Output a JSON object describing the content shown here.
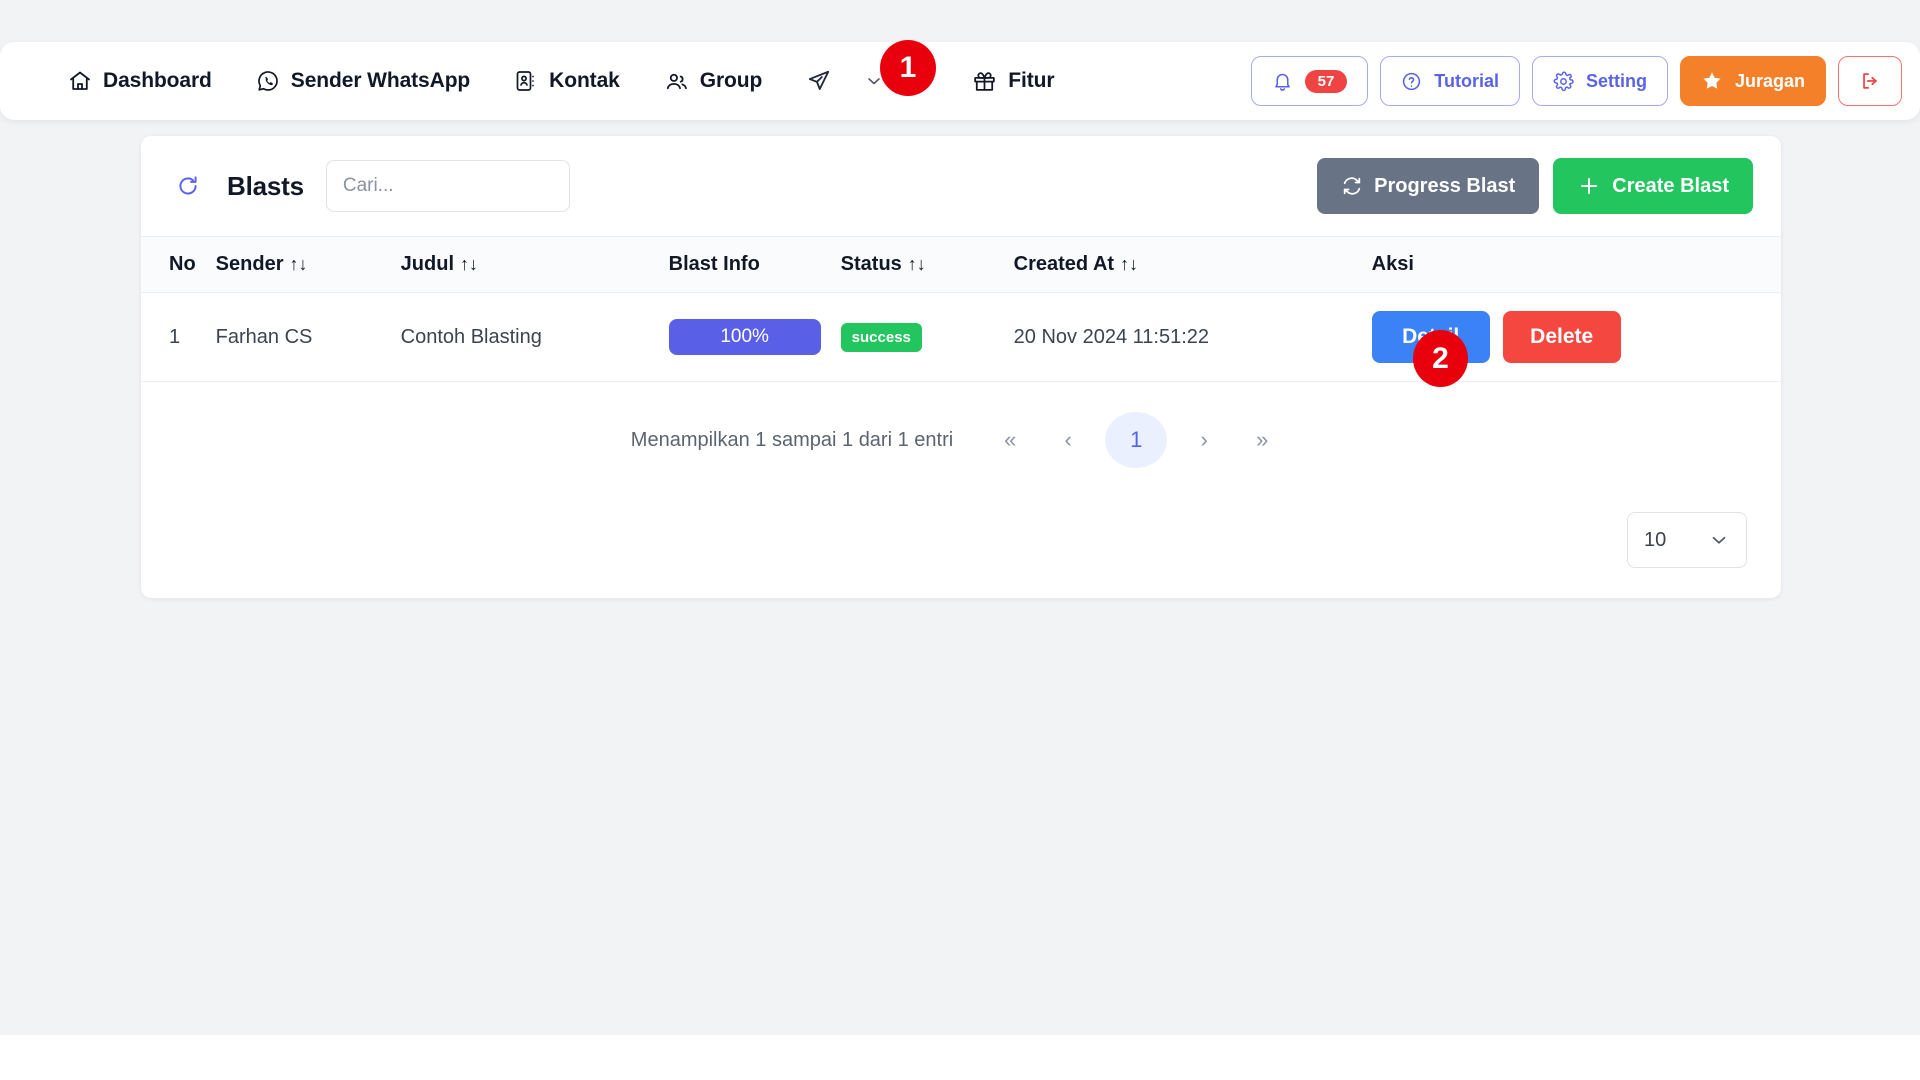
{
  "navbar": {
    "items": [
      {
        "label": "Dashboard",
        "icon": "home-icon"
      },
      {
        "label": "Sender WhatsApp",
        "icon": "whatsapp-icon"
      },
      {
        "label": "Kontak",
        "icon": "contact-card-icon"
      },
      {
        "label": "Group",
        "icon": "people-icon"
      },
      {
        "label": "",
        "icon": "send-paperplane-icon"
      },
      {
        "label": "Fitur",
        "icon": "gift-icon"
      }
    ],
    "notification": {
      "icon": "bell-icon",
      "count": "57"
    },
    "tutorial": {
      "icon": "question-circle-icon",
      "label": "Tutorial"
    },
    "setting": {
      "icon": "gear-icon",
      "label": "Setting"
    },
    "juragan": {
      "icon": "star-icon",
      "label": "Juragan"
    },
    "logout": {
      "icon": "logout-icon"
    }
  },
  "card": {
    "refresh_icon": "refresh-icon",
    "title": "Blasts",
    "search": {
      "value": "",
      "placeholder": "Cari..."
    },
    "progress_blast": {
      "icon": "sync-icon",
      "label": "Progress Blast"
    },
    "create_blast": {
      "icon": "plus-icon",
      "label": "Create Blast"
    }
  },
  "table": {
    "columns": [
      {
        "label": "No",
        "sortable": false
      },
      {
        "label": "Sender",
        "sortable": true
      },
      {
        "label": "Judul",
        "sortable": true
      },
      {
        "label": "Blast Info",
        "sortable": false
      },
      {
        "label": "Status",
        "sortable": true
      },
      {
        "label": "Created At",
        "sortable": true
      },
      {
        "label": "Aksi",
        "sortable": false
      }
    ],
    "sort_glyph": "↑↓",
    "rows": [
      {
        "no": "1",
        "sender": "Farhan CS",
        "judul": "Contoh Blasting",
        "blast_info": "100%",
        "blast_percent": 100,
        "status": "success",
        "created_at": "20 Nov 2024 11:51:22",
        "action_detail": "Detail",
        "action_delete": "Delete"
      }
    ]
  },
  "pagination": {
    "info": "Menampilkan 1 sampai 1 dari 1 entri",
    "first": "«",
    "prev": "‹",
    "current_page": "1",
    "next": "›",
    "last": "»"
  },
  "page_size": {
    "value": "10",
    "chevron": "chevron-down-icon"
  },
  "markers": [
    {
      "label": "1"
    },
    {
      "label": "2"
    }
  ],
  "colors": {
    "page_bg": "#f2f3f5",
    "accent_indigo": "#5a5fe8",
    "success_green": "#22c55e",
    "danger_red": "#f4473f",
    "orange": "#f4812a",
    "slate": "#697386",
    "blue": "#3b82f6",
    "marker_red": "#e8000d"
  }
}
